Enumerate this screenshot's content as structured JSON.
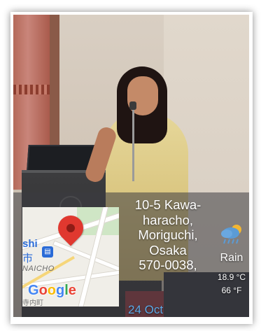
{
  "location": {
    "address": "10-5 Kawa-\nharacho,\nMoriguchi,\nOsaka\n570-0038,",
    "date": "24 Oct"
  },
  "weather": {
    "condition": "Rain",
    "temp_c": "18.9 °C",
    "temp_f": "66 °F",
    "icon": "rain-cloud-sun-icon"
  },
  "map": {
    "label_ishi": "shi",
    "label_shi": "市",
    "label_naicho": "NAICHO",
    "label_naicho2": "寺内町",
    "brand": "Google",
    "brand_colors": [
      "#4285F4",
      "#EA4335",
      "#FBBC05",
      "#4285F4",
      "#34A853",
      "#EA4335"
    ],
    "pin_color": "#e0382f"
  }
}
